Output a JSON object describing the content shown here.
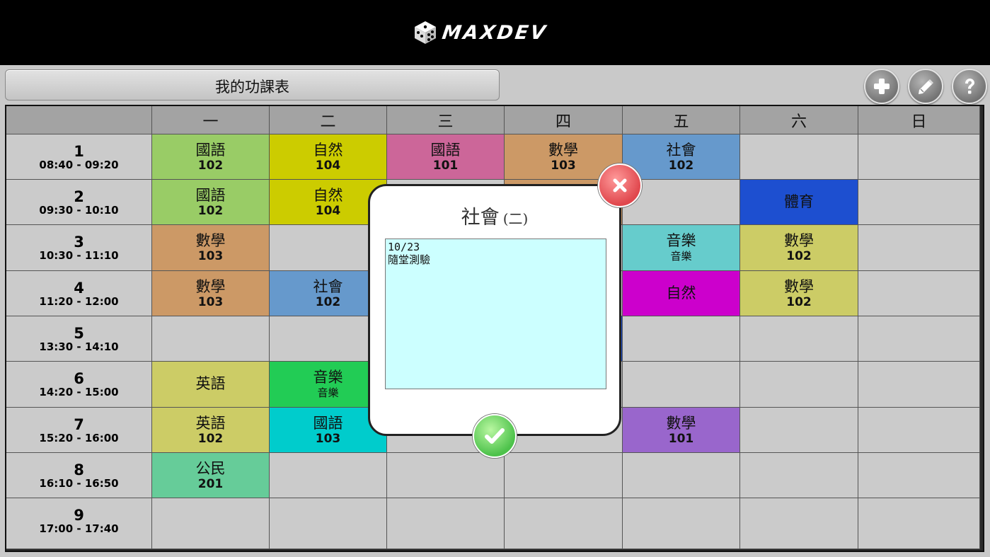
{
  "app": {
    "brand": "MAXDEV",
    "title": "我的功課表"
  },
  "days": [
    "一",
    "二",
    "三",
    "四",
    "五",
    "六",
    "日"
  ],
  "periods": [
    {
      "num": "1",
      "time": "08:40 - 09:20"
    },
    {
      "num": "2",
      "time": "09:30 - 10:10"
    },
    {
      "num": "3",
      "time": "10:30 - 11:10"
    },
    {
      "num": "4",
      "time": "11:20 - 12:00"
    },
    {
      "num": "5",
      "time": "13:30 - 14:10"
    },
    {
      "num": "6",
      "time": "14:20 - 15:00"
    },
    {
      "num": "7",
      "time": "15:20 - 16:00"
    },
    {
      "num": "8",
      "time": "16:10 - 16:50"
    },
    {
      "num": "9",
      "time": "17:00 - 17:40"
    }
  ],
  "rows": [
    [
      {
        "subject": "國語",
        "room": "102",
        "color": "#99cc66"
      },
      {
        "subject": "自然",
        "room": "104",
        "color": "#cccc00"
      },
      {
        "subject": "國語",
        "room": "101",
        "color": "#cc6699"
      },
      {
        "subject": "數學",
        "room": "103",
        "color": "#cc9966"
      },
      {
        "subject": "社會",
        "room": "102",
        "color": "#6699cc"
      },
      {},
      {}
    ],
    [
      {
        "subject": "國語",
        "room": "102",
        "color": "#99cc66"
      },
      {
        "subject": "自然",
        "room": "104",
        "color": "#cccc00"
      },
      {},
      {
        "subject": "",
        "room": "",
        "color": "#cc9966"
      },
      {},
      {
        "subject": "體育",
        "room": "",
        "color": "#1d4fd0"
      },
      {}
    ],
    [
      {
        "subject": "數學",
        "room": "103",
        "color": "#cc9966"
      },
      {},
      {},
      {},
      {
        "subject": "音樂",
        "room": "音樂",
        "color": "#66cccc",
        "note": true
      },
      {
        "subject": "數學",
        "room": "102",
        "color": "#cccc66"
      },
      {}
    ],
    [
      {
        "subject": "數學",
        "room": "103",
        "color": "#cc9966"
      },
      {
        "subject": "社會",
        "room": "102",
        "color": "#6699cc"
      },
      {},
      {},
      {
        "subject": "自然",
        "room": "",
        "color": "#cc00cc"
      },
      {
        "subject": "數學",
        "room": "102",
        "color": "#cccc66"
      },
      {}
    ],
    [
      {},
      {},
      {},
      {
        "subject": "",
        "room": "",
        "color": "#1d4fd0"
      },
      {},
      {},
      {}
    ],
    [
      {
        "subject": "英語",
        "room": "",
        "color": "#cccc66"
      },
      {
        "subject": "音樂",
        "room": "音樂",
        "color": "#22cc55",
        "note": true
      },
      {},
      {},
      {},
      {},
      {}
    ],
    [
      {
        "subject": "英語",
        "room": "102",
        "color": "#cccc66"
      },
      {
        "subject": "國語",
        "room": "103",
        "color": "#00cccc"
      },
      {},
      {},
      {
        "subject": "數學",
        "room": "101",
        "color": "#9966cc"
      },
      {},
      {}
    ],
    [
      {
        "subject": "公民",
        "room": "201",
        "color": "#66cc99"
      },
      {},
      {},
      {},
      {},
      {},
      {}
    ],
    [
      {},
      {},
      {},
      {},
      {},
      {},
      {}
    ]
  ],
  "popup": {
    "subject": "社會",
    "day": "(二)",
    "memo": "10/23\n隨堂測驗"
  },
  "icons": {
    "add": "plus-icon",
    "edit": "pencil-icon",
    "help": "question-icon",
    "close": "x-icon",
    "confirm": "check-icon"
  }
}
